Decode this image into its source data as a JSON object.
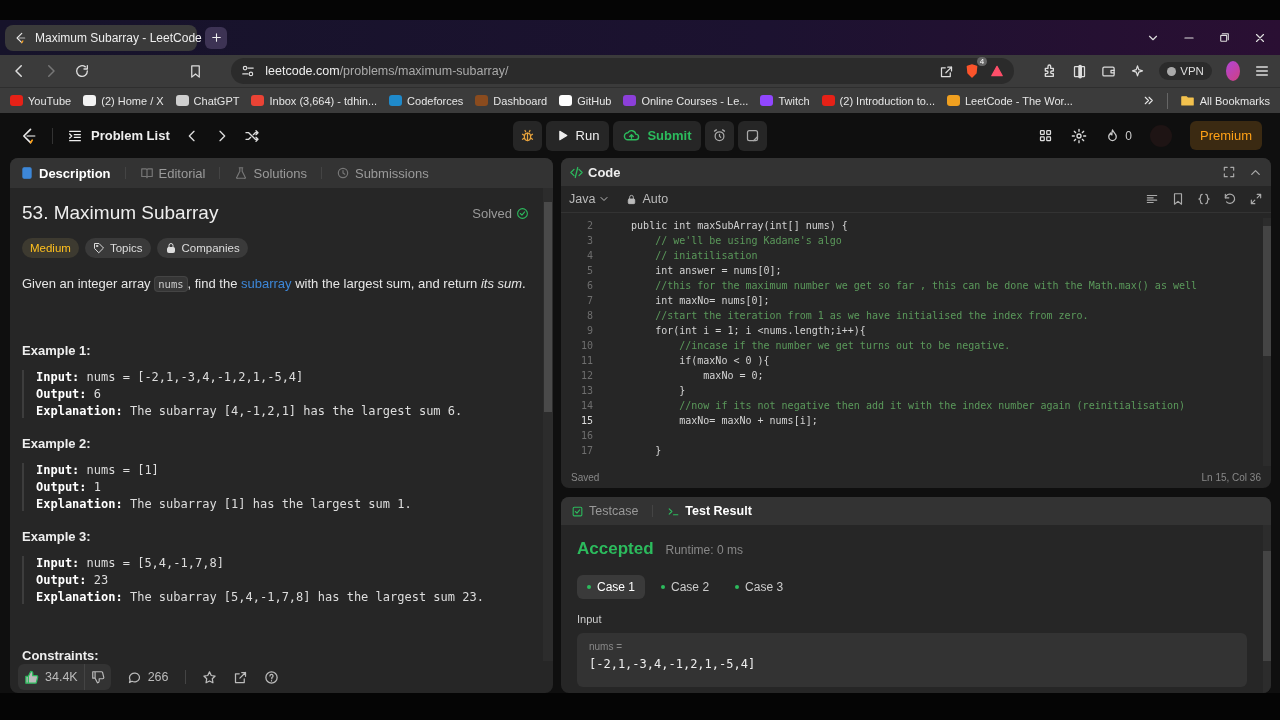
{
  "browser": {
    "tab_title": "Maximum Subarray - LeetCode",
    "url_host": "leetcode.com",
    "url_path": "/problems/maximum-subarray/",
    "shield_badge": "4",
    "vpn": "VPN",
    "all_bookmarks": "All Bookmarks",
    "bookmarks": [
      {
        "label": "YouTube",
        "color": "#e62117"
      },
      {
        "label": "(2) Home / X",
        "color": "#f2f2f2"
      },
      {
        "label": "ChatGPT",
        "color": "#cfcfcf"
      },
      {
        "label": "Inbox (3,664) - tdhin...",
        "color": "#ea4335"
      },
      {
        "label": "Codeforces",
        "color": "#1f8acb"
      },
      {
        "label": "Dashboard",
        "color": "#8a4b1e"
      },
      {
        "label": "GitHub",
        "color": "#ffffff"
      },
      {
        "label": "Online Courses - Le...",
        "color": "#8c3fd9"
      },
      {
        "label": "Twitch",
        "color": "#9146ff"
      },
      {
        "label": "(2) Introduction to...",
        "color": "#e62117"
      },
      {
        "label": "LeetCode - The Wor...",
        "color": "#f0a020"
      }
    ]
  },
  "topbar": {
    "problem_list": "Problem List",
    "run": "Run",
    "submit": "Submit",
    "streak": "0",
    "premium": "Premium"
  },
  "description": {
    "tabs": [
      {
        "label": "Description",
        "selected": true
      },
      {
        "label": "Editorial",
        "selected": false
      },
      {
        "label": "Solutions",
        "selected": false
      },
      {
        "label": "Submissions",
        "selected": false
      }
    ],
    "title": "53. Maximum Subarray",
    "status": "Solved",
    "tags": [
      {
        "kind": "difficulty",
        "label": "Medium"
      },
      {
        "kind": "topics",
        "label": "Topics"
      },
      {
        "kind": "companies",
        "label": "Companies"
      }
    ],
    "statement": {
      "before": "Given an integer array ",
      "code": "nums",
      "middle": ", find the ",
      "link": "subarray",
      "after": " with the largest sum, and return *its sum*."
    },
    "examples": [
      {
        "heading": "Example 1:",
        "lines": [
          "**Input:** nums = [-2,1,-3,4,-1,2,1,-5,4]",
          "**Output:** 6",
          "**Explanation:** The subarray [4,-1,2,1] has the largest sum 6."
        ]
      },
      {
        "heading": "Example 2:",
        "lines": [
          "**Input:** nums = [1]",
          "**Output:** 1",
          "**Explanation:** The subarray [1] has the largest sum 1."
        ]
      },
      {
        "heading": "Example 3:",
        "lines": [
          "**Input:** nums = [5,4,-1,7,8]",
          "**Output:** 23",
          "**Explanation:** The subarray [5,4,-1,7,8] has the largest sum 23."
        ]
      }
    ],
    "constraints_heading": "Constraints:",
    "likes": "34.4K",
    "comments": "266"
  },
  "code": {
    "title": "Code",
    "language": "Java",
    "mode": "Auto",
    "status": "Saved",
    "cursor": "Ln 15, Col 36",
    "lines": [
      {
        "number": "2",
        "text": "    public int maxSubArray(int[] nums) {",
        "kind": "code",
        "current": false
      },
      {
        "number": "3",
        "text": "        // we'll be using Kadane's algo",
        "kind": "comment",
        "current": false
      },
      {
        "number": "4",
        "text": "        // iniatilisation",
        "kind": "comment",
        "current": false
      },
      {
        "number": "5",
        "text": "        int answer = nums[0];",
        "kind": "code",
        "current": false
      },
      {
        "number": "6",
        "text": "        //this for the maximum number we get so far , this can be done with the Math.max() as well",
        "kind": "comment",
        "current": false
      },
      {
        "number": "7",
        "text": "        int maxNo= nums[0];",
        "kind": "code",
        "current": false
      },
      {
        "number": "8",
        "text": "        //start the iteration from 1 as we have initialised the index from zero.",
        "kind": "comment",
        "current": false
      },
      {
        "number": "9",
        "text": "        for(int i = 1; i <nums.length;i++){",
        "kind": "code",
        "current": false
      },
      {
        "number": "10",
        "text": "            //incase if the number we get turns out to be negative.",
        "kind": "comment",
        "current": false
      },
      {
        "number": "11",
        "text": "            if(maxNo < 0 ){",
        "kind": "code",
        "current": false
      },
      {
        "number": "12",
        "text": "                maxNo = 0;",
        "kind": "code",
        "current": false
      },
      {
        "number": "13",
        "text": "            }",
        "kind": "code",
        "current": false
      },
      {
        "number": "14",
        "text": "            //now if its not negative then add it with the index number again (reinitialisation)",
        "kind": "comment",
        "current": false
      },
      {
        "number": "15",
        "text": "            maxNo= maxNo + nums[i];",
        "kind": "code",
        "current": true
      },
      {
        "number": "16",
        "current": false
      },
      {
        "number": "17",
        "text": "        }",
        "kind": "code",
        "current": false
      }
    ]
  },
  "result": {
    "tabs": [
      {
        "label": "Testcase",
        "selected": false
      },
      {
        "label": "Test Result",
        "selected": true
      }
    ],
    "verdict": "Accepted",
    "runtime": "Runtime: 0 ms",
    "cases": [
      {
        "label": "Case 1",
        "selected": true
      },
      {
        "label": "Case 2",
        "selected": false
      },
      {
        "label": "Case 3",
        "selected": false
      }
    ],
    "input_label": "Input",
    "variable": "nums =",
    "value": "[-2,1,-3,4,-1,2,1,-5,4]"
  }
}
